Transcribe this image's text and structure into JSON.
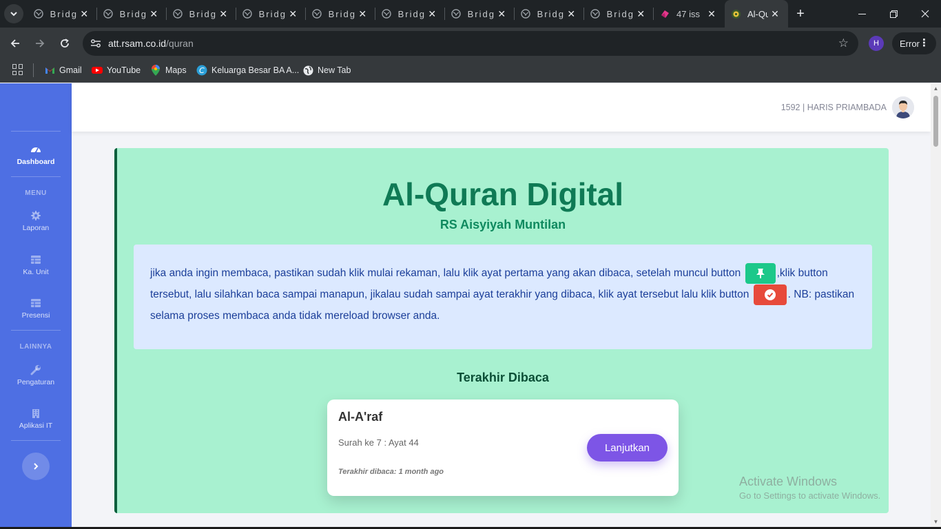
{
  "browser": {
    "tabs": [
      {
        "title": "Bridge",
        "active": false
      },
      {
        "title": "Bridge",
        "active": false
      },
      {
        "title": "Bridge",
        "active": false
      },
      {
        "title": "Bridge",
        "active": false
      },
      {
        "title": "Bridge",
        "active": false
      },
      {
        "title": "Bridge",
        "active": false
      },
      {
        "title": "Bridge",
        "active": false
      },
      {
        "title": "Bridge",
        "active": false
      },
      {
        "title": "Bridge",
        "active": false
      },
      {
        "title": "47 iss",
        "active": false
      },
      {
        "title": "Al-Qu",
        "active": true
      }
    ],
    "url_host": "att.rsam.co.id",
    "url_path": "/quran",
    "profile_initial": "H",
    "error_label": "Error",
    "bookmarks": [
      {
        "label": "Gmail",
        "icon": "gmail-icon"
      },
      {
        "label": "YouTube",
        "icon": "youtube-icon"
      },
      {
        "label": "Maps",
        "icon": "maps-icon"
      },
      {
        "label": "Keluarga Besar BA A...",
        "icon": "canva-icon"
      },
      {
        "label": "New Tab",
        "icon": "globe-icon"
      }
    ]
  },
  "sidebar": {
    "dashboard_label": "Dashboard",
    "menu_heading": "MENU",
    "laporan_label": "Laporan",
    "ka_unit_label": "Ka. Unit",
    "presensi_label": "Presensi",
    "lainnya_heading": "LAINNYA",
    "pengaturan_label": "Pengaturan",
    "aplikasi_it_label": "Aplikasi IT",
    "accent_color": "#4e6fe3"
  },
  "topbar": {
    "user": "1592 | HARIS PRIAMBADA"
  },
  "main": {
    "title": "Al-Quran Digital",
    "subtitle": "RS Aisyiyah Muntilan",
    "instructions": {
      "part1": "jika anda ingin membaca, pastikan sudah klik mulai rekaman, lalu klik ayat pertama yang akan dibaca, setelah muncul button ",
      "part2": ",klik button tersebut, lalu silahkan baca sampai manapun, jikalau sudah sampai ayat terakhir yang dibaca, klik ayat tersebut lalu klik button ",
      "part3": ". NB: pastikan selama proses membaca anda tidak mereload browser anda."
    },
    "last_read_heading": "Terakhir Dibaca",
    "last_read": {
      "surah": "Al-A'raf",
      "info": "Surah ke 7 : Ayat 44",
      "time": "Terakhir dibaca: 1 month ago",
      "button": "Lanjutkan"
    },
    "card_color": "#a8f1d0"
  },
  "watermark": {
    "line1": "Activate Windows",
    "line2": "Go to Settings to activate Windows."
  }
}
